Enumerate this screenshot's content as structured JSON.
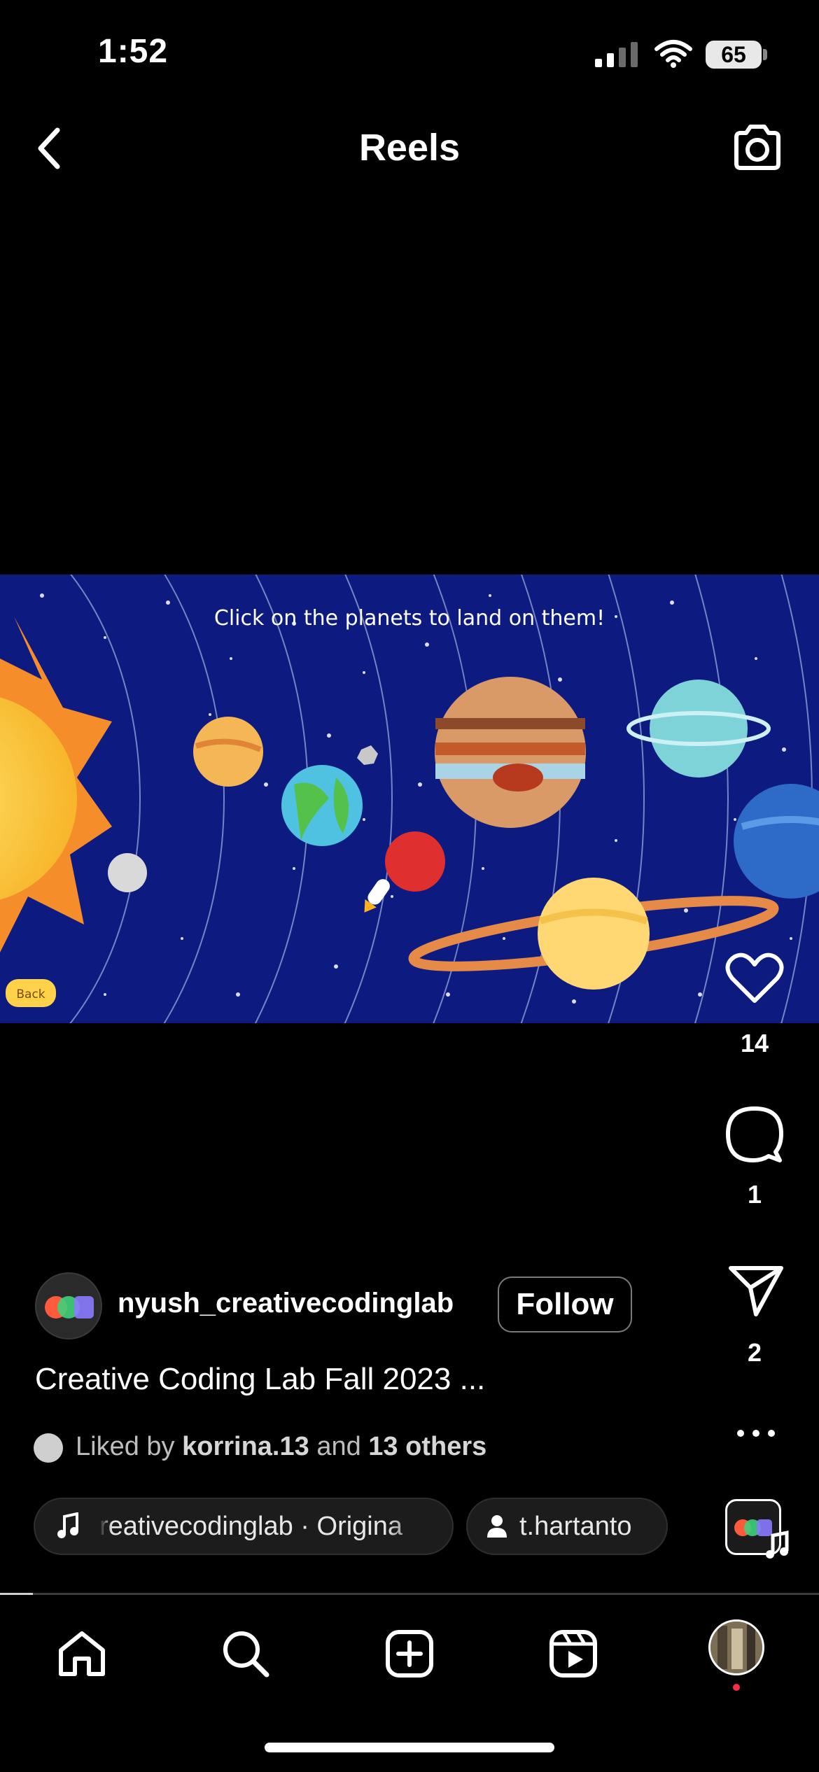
{
  "status_bar": {
    "time": "1:52",
    "battery": "65"
  },
  "header": {
    "title": "Reels"
  },
  "video": {
    "overlay_text": "Click on the planets to land on them!",
    "back_label": "Back"
  },
  "actions": {
    "likes": "14",
    "comments": "1",
    "shares": "2"
  },
  "post": {
    "username": "nyush_creativecodinglab",
    "follow_label": "Follow",
    "caption": "Creative Coding Lab Fall 2023 ...",
    "liked_prefix": "Liked by",
    "liked_user": "korrina.13",
    "liked_and": "and",
    "liked_others": "13 others",
    "audio_label": "reativecodinglab · Origina",
    "tagged_user": "t.hartanto"
  },
  "nav": {
    "progress": 0.04
  },
  "colors": {
    "background": "#000000",
    "video_bg": "#0d1a80",
    "notification": "#ff2a4a"
  }
}
